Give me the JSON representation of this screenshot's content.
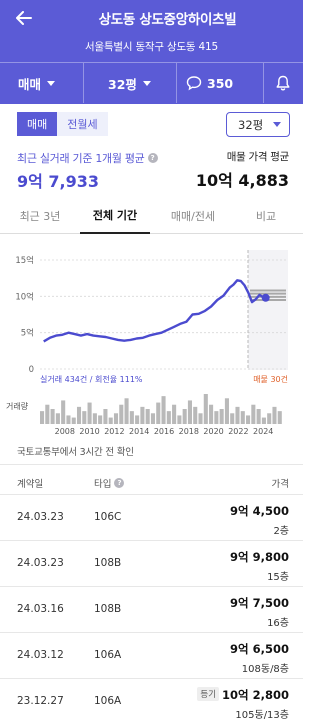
{
  "header": {
    "title": "상도동 상도중앙하이츠빌",
    "address": "서울특별시 동작구 상도동 415",
    "trade_type": "매매",
    "size": "32평",
    "talk_count": "350",
    "bg_color": "#5b5bd6"
  },
  "filters": {
    "toggle": [
      "매매",
      "전월세"
    ],
    "selected_toggle": "매매",
    "size_select": "32평"
  },
  "summary": {
    "avg_label": "최근 실거래 기준 1개월 평균",
    "avg_price": "9억 7,933",
    "ask_label": "매물 가격 평균",
    "ask_price": "10억 4,883"
  },
  "tabs": [
    "최근 3년",
    "전체 기간",
    "매매/전세",
    "비교"
  ],
  "active_tab": "전체 기간",
  "chart_data": {
    "type": "line",
    "y_ticks": [
      "15억",
      "10억",
      "5억",
      "0"
    ],
    "ylim": [
      0,
      15
    ],
    "x_ticks": [
      "2008",
      "2010",
      "2012",
      "2014",
      "2016",
      "2018",
      "2020",
      "2022",
      "2024"
    ],
    "xlim": [
      2006,
      2026
    ],
    "series": [
      {
        "name": "실거래",
        "color": "#4b4bcf",
        "x": [
          2006.3,
          2006.8,
          2007.3,
          2007.8,
          2008.3,
          2008.8,
          2009.3,
          2009.8,
          2010.3,
          2010.8,
          2011.3,
          2011.8,
          2012.3,
          2012.8,
          2013.3,
          2013.8,
          2014.3,
          2014.8,
          2015.3,
          2015.8,
          2016.3,
          2016.8,
          2017.3,
          2017.8,
          2018.3,
          2018.8,
          2019.3,
          2019.8,
          2020.3,
          2020.8,
          2021.3,
          2021.6,
          2021.9,
          2022.2,
          2022.5,
          2022.8,
          2023.1,
          2023.4,
          2023.7,
          2024.0,
          2024.2
        ],
        "values": [
          3.8,
          4.3,
          4.6,
          4.7,
          5.0,
          4.8,
          4.6,
          4.8,
          4.6,
          4.5,
          4.4,
          4.2,
          4.0,
          3.9,
          4.0,
          4.2,
          4.3,
          4.6,
          4.8,
          5.0,
          5.4,
          5.8,
          6.2,
          6.5,
          7.5,
          7.6,
          8.0,
          8.6,
          9.5,
          10.1,
          11.2,
          11.6,
          12.2,
          12.1,
          11.5,
          10.5,
          9.2,
          9.6,
          10.2,
          9.9,
          9.8
        ]
      }
    ],
    "asking_band": [
      9.5,
      10.8
    ],
    "volume_label": "거래량",
    "volume": [
      6,
      9,
      7,
      5,
      11,
      4,
      3,
      8,
      6,
      10,
      5,
      4,
      7,
      3,
      5,
      9,
      12,
      6,
      4,
      8,
      7,
      5,
      10,
      13,
      6,
      9,
      4,
      7,
      11,
      8,
      5,
      14,
      9,
      6,
      7,
      12,
      5,
      8,
      6,
      4,
      9,
      7,
      3,
      5,
      8,
      6
    ],
    "legend_left": "실거래 434건 / 회전율 111%",
    "legend_right": "매물 30건"
  },
  "notice": "국토교통부에서 3시간 전 확인",
  "table": {
    "headers": [
      "계약일",
      "타입",
      "가격"
    ],
    "rows": [
      {
        "date": "24.03.23",
        "type": "106C",
        "price": "9억 4,500",
        "floor": "2층",
        "badge": ""
      },
      {
        "date": "24.03.23",
        "type": "108B",
        "price": "9억 9,800",
        "floor": "15층",
        "badge": ""
      },
      {
        "date": "24.03.16",
        "type": "108B",
        "price": "9억 7,500",
        "floor": "16층",
        "badge": ""
      },
      {
        "date": "24.03.12",
        "type": "106A",
        "price": "9억 6,500",
        "floor": "108동/8층",
        "badge": ""
      },
      {
        "date": "23.12.27",
        "type": "106A",
        "price": "10억 2,800",
        "floor": "105동/13층",
        "badge": "등기"
      }
    ]
  }
}
